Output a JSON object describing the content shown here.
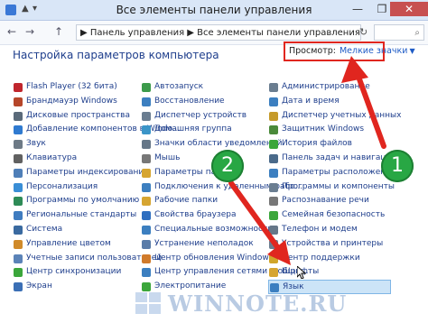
{
  "window": {
    "title": "Все элементы панели управления",
    "minimize": "—",
    "maximize": "❐",
    "close": "✕"
  },
  "quick_access": [
    "▲",
    "▾"
  ],
  "nav": {
    "back": "←",
    "forward": "→",
    "up": "↑",
    "address": "▶ Панель управления ▶ Все элементы панели управления",
    "refresh": "↻",
    "search_icon": "⌕"
  },
  "page": {
    "title": "Настройка параметров компьютера",
    "view_label": "Просмотр:",
    "view_value": "Мелкие значки",
    "view_arrow": "▼"
  },
  "columns": [
    [
      {
        "label": "Flash Player (32 бита)",
        "icon": "flash-icon",
        "color": "#c0262d"
      },
      {
        "label": "Брандмауэр Windows",
        "icon": "firewall-icon",
        "color": "#b6462a"
      },
      {
        "label": "Дисковые пространства",
        "icon": "disk-icon",
        "color": "#5a6a7a"
      },
      {
        "label": "Добавление компонентов в Windo...",
        "icon": "add-features-icon",
        "color": "#2f7ad0"
      },
      {
        "label": "Звук",
        "icon": "sound-icon",
        "color": "#6d7a86"
      },
      {
        "label": "Клавиатура",
        "icon": "keyboard-icon",
        "color": "#616161"
      },
      {
        "label": "Параметры индексирования",
        "icon": "indexing-icon",
        "color": "#4f7fb8"
      },
      {
        "label": "Персонализация",
        "icon": "personalization-icon",
        "color": "#3a8ed6"
      },
      {
        "label": "Программы по умолчанию",
        "icon": "default-programs-icon",
        "color": "#2e8b57"
      },
      {
        "label": "Региональные стандарты",
        "icon": "region-icon",
        "color": "#3f7cc0"
      },
      {
        "label": "Система",
        "icon": "system-icon",
        "color": "#3a6aa0"
      },
      {
        "label": "Управление цветом",
        "icon": "color-icon",
        "color": "#d08a2a"
      },
      {
        "label": "Учетные записи пользователей",
        "icon": "user-accounts-icon",
        "color": "#5b83b8"
      },
      {
        "label": "Центр синхронизации",
        "icon": "sync-icon",
        "color": "#3ba63b"
      },
      {
        "label": "Экран",
        "icon": "display-icon",
        "color": "#3b6fb5"
      }
    ],
    [
      {
        "label": "Автозапуск",
        "icon": "autoplay-icon",
        "color": "#3c9b4b"
      },
      {
        "label": "Восстановление",
        "icon": "recovery-icon",
        "color": "#3c7fc0"
      },
      {
        "label": "Диспетчер устройств",
        "icon": "device-manager-icon",
        "color": "#6a7d90"
      },
      {
        "label": "Домашняя группа",
        "icon": "homegroup-icon",
        "color": "#3b95c8"
      },
      {
        "label": "Значки области уведомлений",
        "icon": "tray-icons-icon",
        "color": "#667788"
      },
      {
        "label": "Мышь",
        "icon": "mouse-icon",
        "color": "#777777"
      },
      {
        "label": "Параметры папок",
        "icon": "folder-options-icon",
        "color": "#d6a531"
      },
      {
        "label": "Подключения к удаленным рабо...",
        "icon": "remote-connections-icon",
        "color": "#3c7fc0"
      },
      {
        "label": "Рабочие папки",
        "icon": "work-folders-icon",
        "color": "#d6a531"
      },
      {
        "label": "Свойства браузера",
        "icon": "browser-icon",
        "color": "#2f6fc0"
      },
      {
        "label": "Специальные возможности",
        "icon": "accessibility-icon",
        "color": "#3c7fc0"
      },
      {
        "label": "Устранение неполадок",
        "icon": "troubleshoot-icon",
        "color": "#5a7ca8"
      },
      {
        "label": "Центр обновления Windows",
        "icon": "windows-update-icon",
        "color": "#d07a2a"
      },
      {
        "label": "Центр управления сетями и общи...",
        "icon": "network-center-icon",
        "color": "#3c7fc0"
      },
      {
        "label": "Электропитание",
        "icon": "power-icon",
        "color": "#3ba63b"
      }
    ],
    [
      {
        "label": "Администрирование",
        "icon": "admin-tools-icon",
        "color": "#6a7d90"
      },
      {
        "label": "Дата и время",
        "icon": "datetime-icon",
        "color": "#3c7fc0"
      },
      {
        "label": "Диспетчер учетных данных",
        "icon": "credentials-icon",
        "color": "#c59a2a"
      },
      {
        "label": "Защитник Windows",
        "icon": "defender-icon",
        "color": "#4a8a3a"
      },
      {
        "label": "История файлов",
        "icon": "file-history-icon",
        "color": "#3ba63b"
      },
      {
        "label": "Панель задач и навигация",
        "icon": "taskbar-icon",
        "color": "#4a6a8a"
      },
      {
        "label": "Параметры расположения",
        "icon": "location-icon",
        "color": "#3c7fc0"
      },
      {
        "label": "Программы и компоненты",
        "icon": "programs-icon",
        "color": "#6a7d90"
      },
      {
        "label": "Распознавание речи",
        "icon": "speech-icon",
        "color": "#777777"
      },
      {
        "label": "Семейная безопасность",
        "icon": "family-safety-icon",
        "color": "#3ba63b"
      },
      {
        "label": "Телефон и модем",
        "icon": "phone-modem-icon",
        "color": "#667788"
      },
      {
        "label": "Устройства и принтеры",
        "icon": "devices-printers-icon",
        "color": "#6a7d90"
      },
      {
        "label": "Центр поддержки",
        "icon": "action-center-icon",
        "color": "#d0a52a"
      },
      {
        "label": "Шрифты",
        "icon": "fonts-icon",
        "color": "#d6a531"
      },
      {
        "label": "Язык",
        "icon": "language-icon",
        "color": "#3c7fc0",
        "selected": true
      }
    ]
  ],
  "badges": {
    "one": "1",
    "two": "2"
  },
  "watermark": {
    "text": "WINNOTE.RU"
  },
  "colors": {
    "accent": "#1e3e8c",
    "highlight": "#e0261f",
    "badge": "#28a744"
  }
}
